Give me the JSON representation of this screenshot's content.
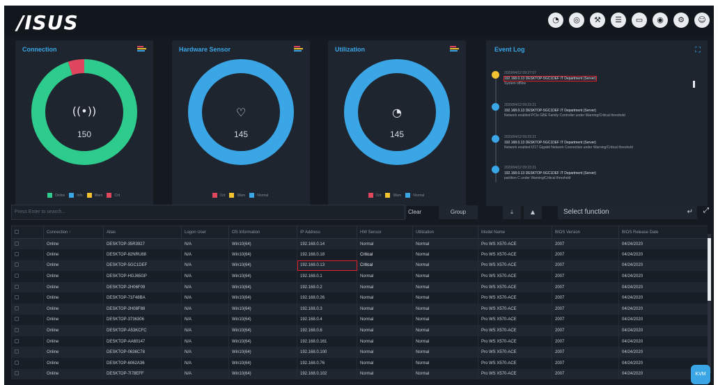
{
  "brand": {
    "logo_text": "/ISUS"
  },
  "header": {
    "icons": [
      "gauge-icon",
      "globe-icon",
      "tools-icon",
      "clipboard-icon",
      "monitor-icon",
      "alert-icon",
      "settings-icon",
      "user-icon"
    ],
    "icon_glyphs": [
      "◔",
      "◎",
      "⚒",
      "☰",
      "▭",
      "◉",
      "⚙",
      "☺"
    ]
  },
  "colors": {
    "accent": "#3aa6e6",
    "online": "#2ecc8c",
    "warning": "#f2c230",
    "critical": "#e0465e",
    "highlight": "#e0202a"
  },
  "cards": {
    "connection": {
      "title": "Connection",
      "value": "150",
      "icon": "broadcast-icon",
      "glyph": "((•))",
      "segments": [
        {
          "color": "#2ecc8c",
          "fraction": 0.95
        },
        {
          "color": "#e0465e",
          "fraction": 0.05
        }
      ]
    },
    "hardware": {
      "title": "Hardware Sensor",
      "value": "145",
      "icon": "heart-rate-icon",
      "glyph": "♡",
      "segments": [
        {
          "color": "#3aa6e6",
          "fraction": 1.0
        }
      ]
    },
    "utilization": {
      "title": "Utilization",
      "value": "145",
      "icon": "gauge-icon",
      "glyph": "◔",
      "segments": [
        {
          "color": "#3aa6e6",
          "fraction": 1.0
        }
      ]
    }
  },
  "event_log": {
    "title": "Event Log",
    "events": [
      {
        "date": "2020/04/12 09:27:07",
        "line1": "192.168.0.13 DESKTOP-5GC1DEF IT Department (Server)",
        "line2": "System offline",
        "color": "#f2c230"
      },
      {
        "date": "2020/04/12 09:23:21",
        "line1": "192.168.0.13 DESKTOP-5GC1DEF IT Department (Server)",
        "line2": "Network enabled PCIe GBE Family Controller under Warning/Critical threshold",
        "color": "#3aa6e6"
      },
      {
        "date": "2020/04/12 09:23:21",
        "line1": "192.168.0.13 DESKTOP-5GC1DEF IT Department (Server)",
        "line2": "Network enabled I217 Gigabit Network Connection under Warning/Critical threshold",
        "color": "#3aa6e6"
      },
      {
        "date": "2020/04/12 09:23:21",
        "line1": "192.168.0.13 DESKTOP-5GC1DEF IT Department (Server)",
        "line2": "partition C under Warning/Critical threshold",
        "color": "#3aa6e6"
      }
    ]
  },
  "toolbar": {
    "search_placeholder": "Press Enter to search...",
    "clear_label": "Clear",
    "group_label": "Group",
    "filter_glyph": "⤓",
    "up_glyph": "▲",
    "select_value": "Select function",
    "enter_glyph": "↵",
    "fullscreen_glyph": "⤢"
  },
  "table": {
    "columns": [
      "",
      "Connection ↑",
      "Alias",
      "Logon User",
      "OS Information",
      "IP Address",
      "HW Sensor",
      "Utilization",
      "Model Name",
      "BIOS Version",
      "BIOS Release Date"
    ],
    "rows": [
      [
        "Online",
        "DESKTOP-35R3927",
        "N/A",
        "Win10(64)",
        "192.168.0.14",
        "Normal",
        "Normal",
        "Pro WS X570-ACE",
        "2007",
        "04/24/2020"
      ],
      [
        "Online",
        "DESKTOP-82NRU88",
        "N/A",
        "Win10(64)",
        "192.168.0.18",
        "Critical",
        "Normal",
        "Pro WS X570-ACE",
        "2007",
        "04/24/2020"
      ],
      [
        "Online",
        "DESKTOP-5GC1DEF",
        "N/A",
        "Win10(64)",
        "192.168.0.13",
        "Critical",
        "Normal",
        "Pro WS X570-ACE",
        "2007",
        "04/24/2020"
      ],
      [
        "Online",
        "DESKTOP-HGJ65GP",
        "N/A",
        "Win10(64)",
        "192.168.0.1",
        "Normal",
        "Normal",
        "Pro WS X570-ACE",
        "2007",
        "04/24/2020"
      ],
      [
        "Online",
        "DESKTOP-2H06F09",
        "N/A",
        "Win10(64)",
        "192.168.0.2",
        "Normal",
        "Normal",
        "Pro WS X570-ACE",
        "2007",
        "04/24/2020"
      ],
      [
        "Online",
        "DESKTOP-71F48BA",
        "N/A",
        "Win10(64)",
        "192.168.0.26",
        "Normal",
        "Normal",
        "Pro WS X570-ACE",
        "2007",
        "04/24/2020"
      ],
      [
        "Online",
        "DESKTOP-2H08F88",
        "N/A",
        "Win10(64)",
        "192.168.0.3",
        "Normal",
        "Normal",
        "Pro WS X570-ACE",
        "2007",
        "04/24/2020"
      ],
      [
        "Online",
        "DESKTOP-3736306",
        "N/A",
        "Win10(64)",
        "192.168.0.4",
        "Normal",
        "Normal",
        "Pro WS X570-ACE",
        "2007",
        "04/24/2020"
      ],
      [
        "Online",
        "DESKTOP-A53KCFC",
        "N/A",
        "Win10(64)",
        "192.168.0.6",
        "Normal",
        "Normal",
        "Pro WS X570-ACE",
        "2007",
        "04/24/2020"
      ],
      [
        "Online",
        "DESKTOP-AA60147",
        "N/A",
        "Win10(64)",
        "192.168.0.161",
        "Normal",
        "Normal",
        "Pro WS X570-ACE",
        "2007",
        "04/24/2020"
      ],
      [
        "Online",
        "DESKTOP-0636C78",
        "N/A",
        "Win10(64)",
        "192.168.0.100",
        "Normal",
        "Normal",
        "Pro WS X570-ACE",
        "2007",
        "04/24/2020"
      ],
      [
        "Online",
        "DESKTOP-6062A36",
        "N/A",
        "Win10(64)",
        "192.168.0.76",
        "Normal",
        "Normal",
        "Pro WS X570-ACE",
        "2007",
        "04/24/2020"
      ],
      [
        "Online",
        "DESKTOP-7I78EFF",
        "N/A",
        "Win10(64)",
        "192.168.0.102",
        "Normal",
        "Normal",
        "Pro WS X570-ACE",
        "2007",
        "04/24/2020"
      ]
    ]
  },
  "float_badge": "KVM"
}
